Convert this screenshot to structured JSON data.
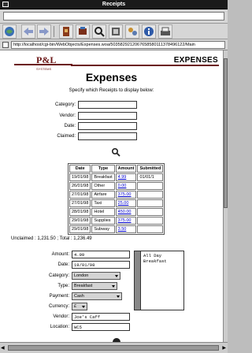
{
  "window": {
    "title": "Receipts"
  },
  "browser": {
    "url": "http://localhost/cgi-bin/WebObjects/Expenses.woa/5035829212067658580111378496122/Main",
    "toolbar": [
      "home-icon",
      "back-icon",
      "forward-icon",
      "bookmark-icon",
      "print-icon",
      "find-icon",
      "options-icon",
      "security-icon",
      "info-icon",
      "print-page-icon"
    ]
  },
  "header": {
    "brand": "EXPENSES",
    "logo_text": "P&L SYSTEMS",
    "title": "Expenses",
    "intro": "Specify which Receipts to display below:"
  },
  "filters": [
    {
      "label": "Category:",
      "value": ""
    },
    {
      "label": "Vendor:",
      "value": ""
    },
    {
      "label": "Date:",
      "value": ""
    },
    {
      "label": "Claimed:",
      "value": ""
    }
  ],
  "table": {
    "headers": [
      "Date",
      "Type",
      "Amount",
      "Submitted"
    ],
    "rows": [
      [
        "19/01/98",
        "Breakfast",
        "4.99",
        "01/01/1"
      ],
      [
        "26/01/98",
        "Other",
        "0.00",
        ""
      ],
      [
        "27/01/98",
        "Airfare",
        "375.00",
        ""
      ],
      [
        "27/01/98",
        "Taxi",
        "25.00",
        ""
      ],
      [
        "28/01/98",
        "Hotel",
        "450.00",
        ""
      ],
      [
        "29/01/98",
        "Supplies",
        "375.00",
        ""
      ],
      [
        "29/01/98",
        "Subway",
        "3.50",
        ""
      ]
    ]
  },
  "totals": "Unclaimed : 1,231.50 ; Total : 1,236.49",
  "detail": {
    "amount_label": "Amount:",
    "amount": "4.99",
    "date_label": "Date:",
    "date": "19/01/98",
    "category_label": "Category:",
    "category": "London",
    "type_label": "Type:",
    "type": "Breakfast",
    "payment_label": "Payment:",
    "payment": "Cash",
    "currency_label": "Currency:",
    "currency": "£",
    "vendor_label": "Vendor:",
    "vendor": "Joe's Caff",
    "location_label": "Location:",
    "location": "WC5",
    "notes": "All Day\nBreakfast"
  }
}
